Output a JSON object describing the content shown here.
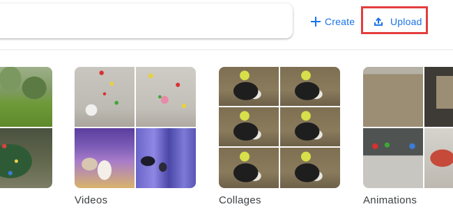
{
  "toolbar": {
    "create_label": "Create",
    "upload_label": "Upload",
    "highlight_color": "#e43d3d",
    "accent_color": "#1a73e8"
  },
  "albums": [
    {
      "label": ""
    },
    {
      "label": "Videos"
    },
    {
      "label": "Collages"
    },
    {
      "label": "Animations"
    }
  ],
  "icons": {
    "create": "plus-icon",
    "upload": "upload-icon"
  }
}
